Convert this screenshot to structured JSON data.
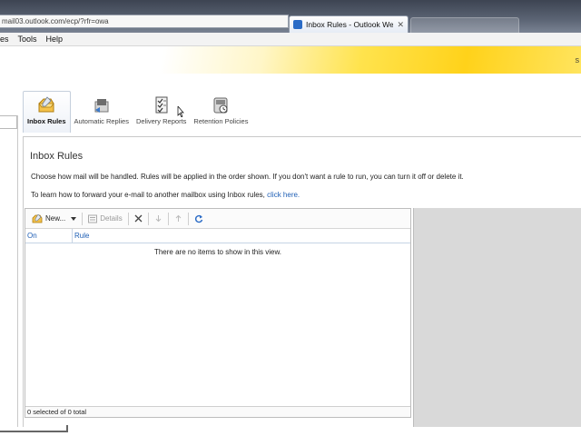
{
  "browser": {
    "address": "mail03.outlook.com/ecp/?rfr=owa",
    "active_tab_title": "Inbox Rules - Outlook Web ...",
    "active_tab_close": "✕"
  },
  "menu": {
    "items": [
      "es",
      "Tools",
      "Help"
    ]
  },
  "header": {
    "edge_text": "S"
  },
  "categories": [
    {
      "label": "Inbox Rules",
      "icon": "inbox-rules-icon",
      "active": true
    },
    {
      "label": "Automatic Replies",
      "icon": "automatic-replies-icon",
      "active": false
    },
    {
      "label": "Delivery Reports",
      "icon": "delivery-reports-icon",
      "active": false
    },
    {
      "label": "Retention Policies",
      "icon": "retention-policies-icon",
      "active": false
    }
  ],
  "panel": {
    "title": "Inbox Rules",
    "description": "Choose how mail will be handled. Rules will be applied in the order shown. If you don't want a rule to run, you can turn it off or delete it.",
    "forward_text": "To learn how to forward your e-mail to another mailbox using Inbox rules,",
    "forward_link": "click here."
  },
  "list": {
    "toolbar": {
      "new_label": "New...",
      "details_label": "Details"
    },
    "columns": [
      "On",
      "Rule"
    ],
    "empty_message": "There are no items to show in this view.",
    "status": "0 selected of 0 total"
  },
  "colors": {
    "accent": "#ffd21a",
    "link": "#1f5fb5"
  }
}
